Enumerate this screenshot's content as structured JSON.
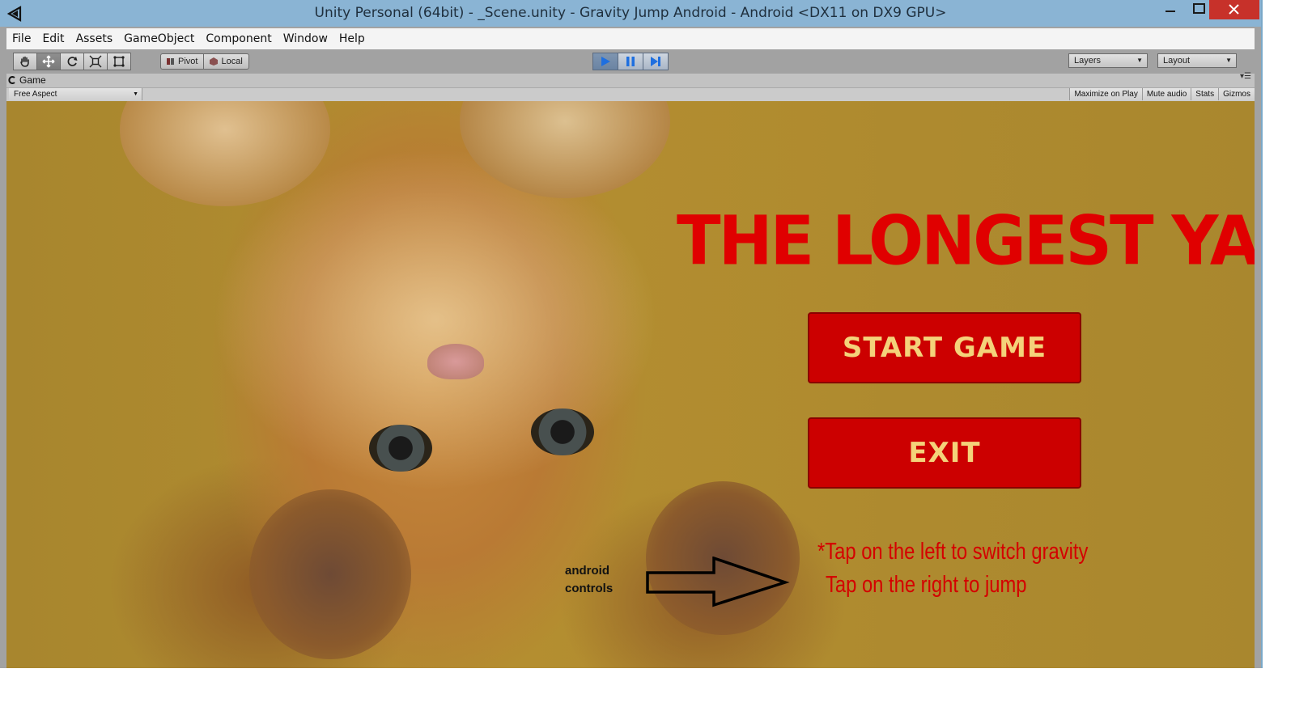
{
  "window": {
    "title": "Unity Personal (64bit) - _Scene.unity - Gravity Jump Android - Android <DX11 on DX9 GPU>"
  },
  "menu": [
    "File",
    "Edit",
    "Assets",
    "GameObject",
    "Component",
    "Window",
    "Help"
  ],
  "toolbar": {
    "pivot_label": "Pivot",
    "local_label": "Local",
    "layers_label": "Layers",
    "layout_label": "Layout",
    "play_state": "playing"
  },
  "panel": {
    "tab_label": "Game",
    "aspect_label": "Free Aspect",
    "buttons": [
      "Maximize on Play",
      "Mute audio",
      "Stats",
      "Gizmos"
    ]
  },
  "game": {
    "title": "THE LONGEST YARN",
    "start_label": "START GAME",
    "exit_label": "EXIT",
    "controls_label_line1": "android",
    "controls_label_line2": "controls",
    "hint_line1": "*Tap on the left to switch gravity",
    "hint_line2": "Tap on the right  to jump"
  },
  "colors": {
    "title_red": "#e00000",
    "button_red": "#cc0000",
    "button_text": "#f4d27a",
    "titlebar": "#8ab4d4",
    "close_button": "#c7312a"
  }
}
